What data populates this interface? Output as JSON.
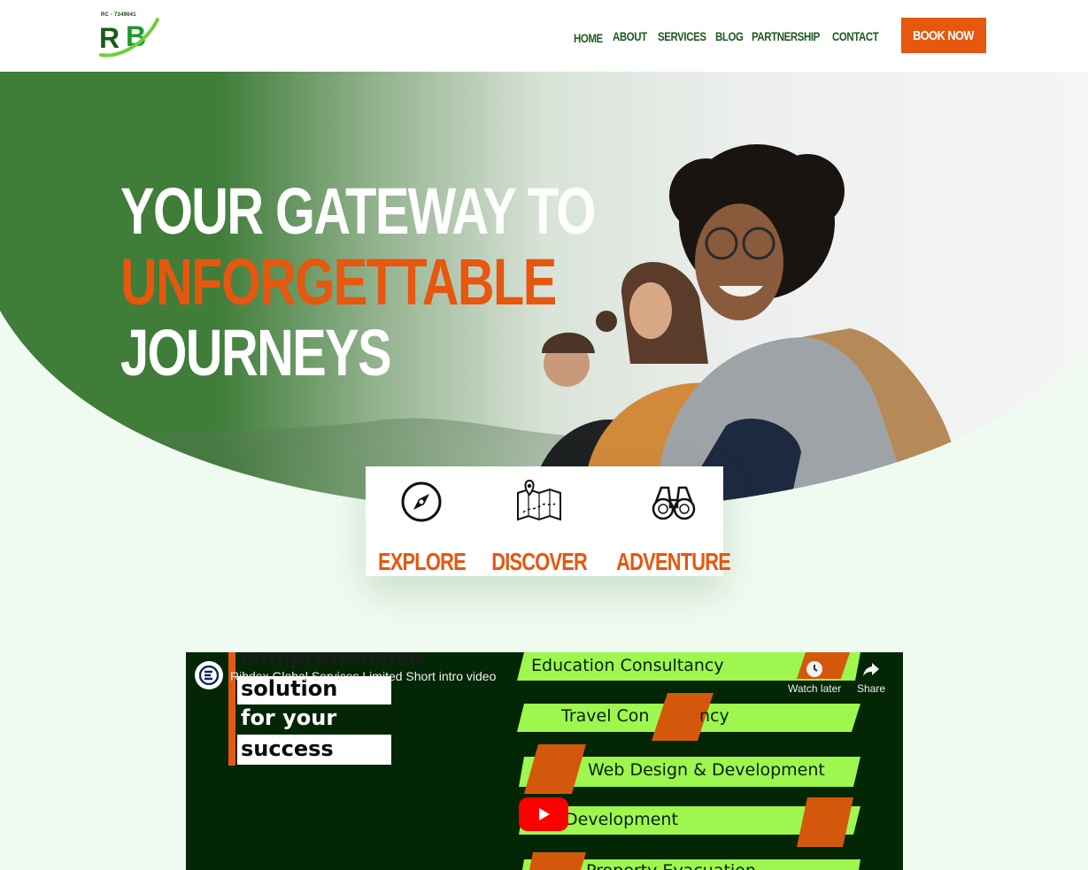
{
  "brand": {
    "rc_number": "RC - 7349041",
    "logo_letters": "RB"
  },
  "nav": {
    "items": [
      "HOME",
      "ABOUT",
      "SERVICES",
      "BLOG",
      "PARTNERSHIP",
      "CONTACT"
    ],
    "cta_label": "BOOK NOW"
  },
  "hero": {
    "line1": "YOUR GATEWAY TO",
    "line2": "UNFORGETTABLE",
    "line3": "JOURNEYS"
  },
  "features": [
    {
      "label": "EXPLORE",
      "icon": "compass-icon"
    },
    {
      "label": "DISCOVER",
      "icon": "map-icon"
    },
    {
      "label": "ADVENTURE",
      "icon": "binoculars-icon"
    }
  ],
  "video": {
    "title": "Ribdex Global Services Limited Short intro video",
    "watch_later": "Watch later",
    "share": "Share",
    "slide_words": [
      "comprehensive",
      "solution",
      "for your",
      "success"
    ],
    "services": [
      "Education Consultancy",
      "Travel Con",
      "ncy",
      "Web Design & Development",
      "Development",
      "Property Evacuation"
    ]
  },
  "colors": {
    "brand_green": "#1e5a1e",
    "accent_orange": "#e6570f",
    "hero_green": "#3a7a35",
    "page_mint": "#effbf1",
    "video_bg": "#032604",
    "slide_lime": "#9df74e",
    "youtube_red": "#ff0000"
  }
}
